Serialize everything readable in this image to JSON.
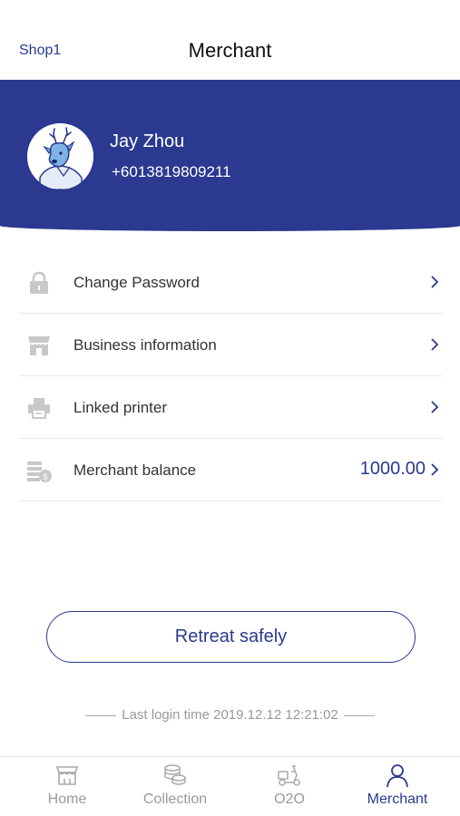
{
  "header": {
    "shop_link": "Shop1",
    "title": "Merchant"
  },
  "profile": {
    "name": "Jay Zhou",
    "phone": "+6013819809211"
  },
  "menu": [
    {
      "label": "Change Password",
      "icon": "lock-icon"
    },
    {
      "label": "Business information",
      "icon": "store-icon"
    },
    {
      "label": "Linked printer",
      "icon": "printer-icon"
    },
    {
      "label": "Merchant balance",
      "icon": "coins-icon",
      "value": "1000.00"
    }
  ],
  "retreat_label": "Retreat safely",
  "last_login": "Last login time 2019.12.12 12:21:02",
  "tabbar": [
    {
      "label": "Home",
      "icon": "store-icon",
      "active": false
    },
    {
      "label": "Collection",
      "icon": "coins-stack-icon",
      "active": false
    },
    {
      "label": "O2O",
      "icon": "scooter-icon",
      "active": false
    },
    {
      "label": "Merchant",
      "icon": "person-icon",
      "active": true
    }
  ],
  "colors": {
    "accent": "#2b3990",
    "muted": "#999999",
    "divider": "#e8e8e8"
  }
}
